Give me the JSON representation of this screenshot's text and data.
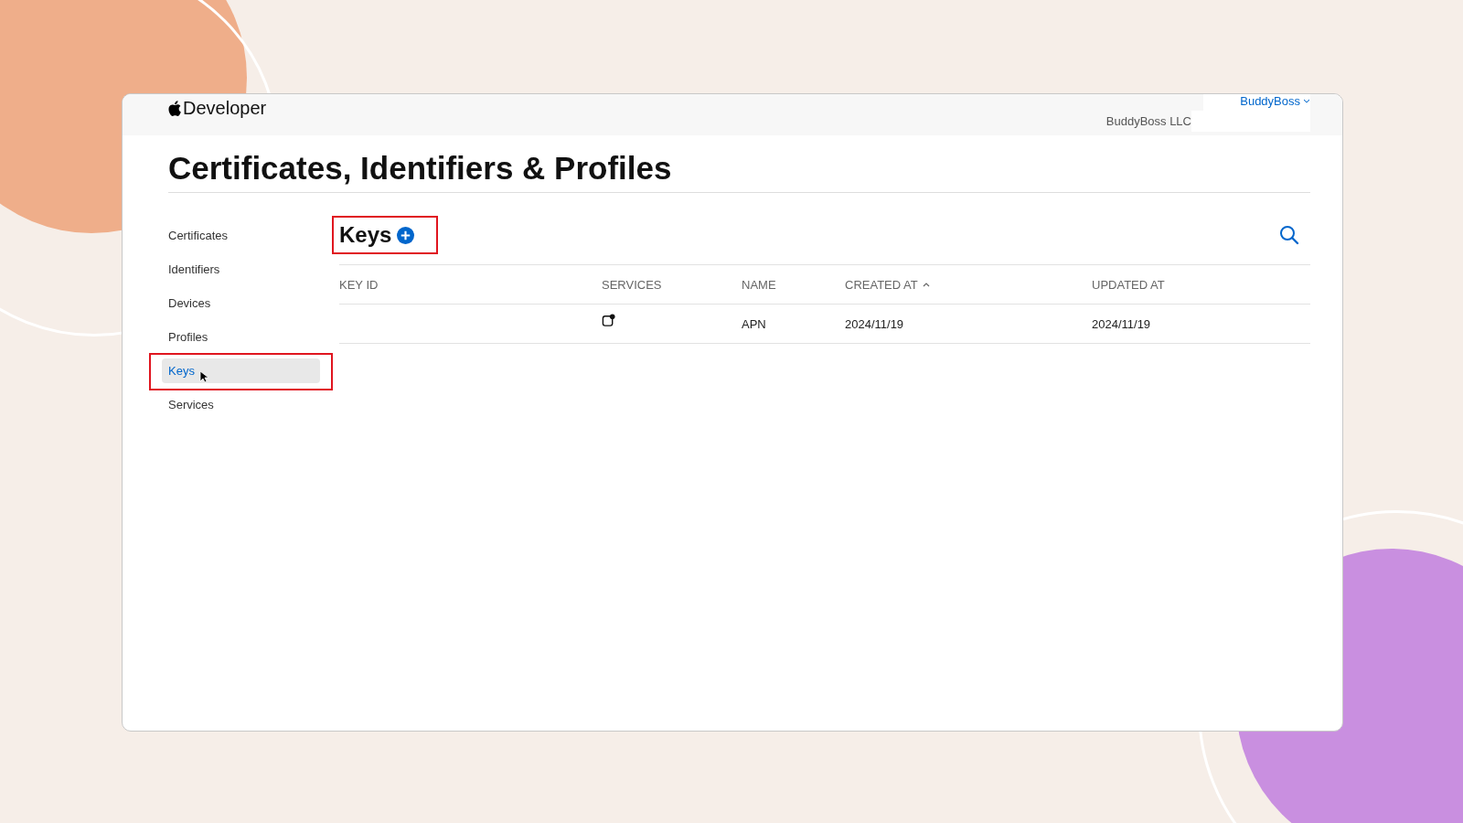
{
  "header": {
    "brand": "Developer",
    "account": "BuddyBoss",
    "team": "BuddyBoss LLC"
  },
  "title": "Certificates, Identifiers & Profiles",
  "sidebar": {
    "items": [
      {
        "label": "Certificates",
        "selected": false,
        "annotated": false
      },
      {
        "label": "Identifiers",
        "selected": false,
        "annotated": false
      },
      {
        "label": "Devices",
        "selected": false,
        "annotated": false
      },
      {
        "label": "Profiles",
        "selected": false,
        "annotated": false
      },
      {
        "label": "Keys",
        "selected": true,
        "annotated": true
      },
      {
        "label": "Services",
        "selected": false,
        "annotated": false
      }
    ]
  },
  "section": {
    "title": "Keys",
    "annotated": true
  },
  "table": {
    "columns": [
      {
        "label": "KEY ID",
        "sorted": false
      },
      {
        "label": "SERVICES",
        "sorted": false
      },
      {
        "label": "NAME",
        "sorted": false
      },
      {
        "label": "CREATED AT",
        "sorted": true
      },
      {
        "label": "UPDATED AT",
        "sorted": false
      }
    ],
    "rows": [
      {
        "name": "APN",
        "created_at": "2024/11/19",
        "updated_at": "2024/11/19"
      }
    ]
  }
}
